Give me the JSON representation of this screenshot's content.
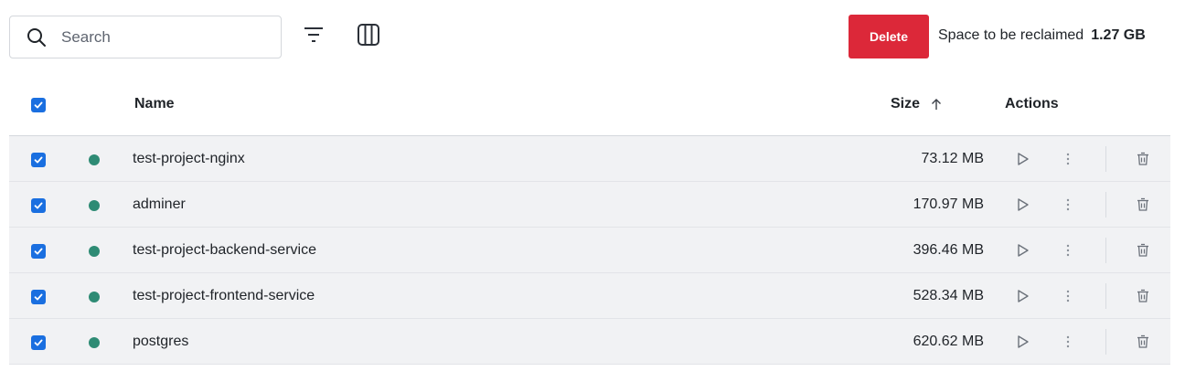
{
  "toolbar": {
    "search_placeholder": "Search",
    "search_value": "",
    "delete_label": "Delete",
    "reclaim_label": "Space to be reclaimed",
    "reclaim_value": "1.27 GB"
  },
  "table": {
    "headers": {
      "name": "Name",
      "size": "Size",
      "actions": "Actions"
    },
    "sort": {
      "column": "size",
      "direction": "ascending"
    },
    "select_all_checked": true,
    "rows": [
      {
        "checked": true,
        "name": "test-project-nginx",
        "size": "73.12 MB"
      },
      {
        "checked": true,
        "name": "adminer",
        "size": "170.97 MB"
      },
      {
        "checked": true,
        "name": "test-project-backend-service",
        "size": "396.46 MB"
      },
      {
        "checked": true,
        "name": "test-project-frontend-service",
        "size": "528.34 MB"
      },
      {
        "checked": true,
        "name": "postgres",
        "size": "620.62 MB"
      }
    ]
  },
  "colors": {
    "accent": "#1a6fe0",
    "danger": "#dc2839",
    "status_dot": "#2e8b74",
    "row_bg": "#f1f2f4"
  },
  "icons": [
    "search-icon",
    "filter-icon",
    "columns-icon",
    "sort-arrow-up-icon",
    "checkmark-icon",
    "play-icon",
    "more-vertical-icon",
    "trash-icon"
  ]
}
